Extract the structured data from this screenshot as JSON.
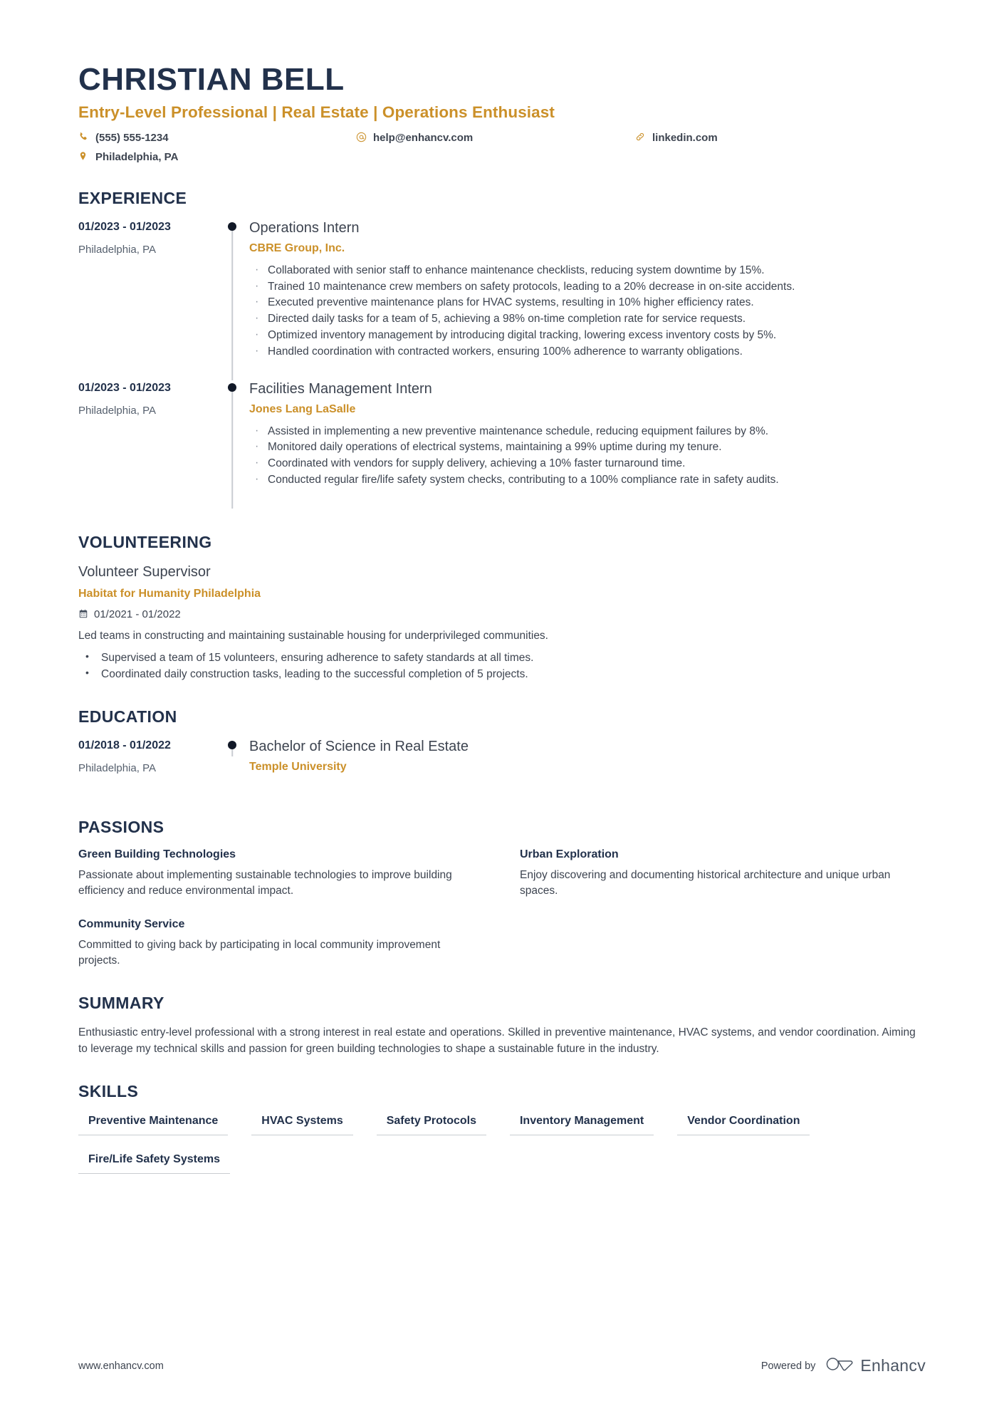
{
  "header": {
    "name": "CHRISTIAN BELL",
    "headline": "Entry-Level Professional | Real Estate | Operations Enthusiast",
    "contacts": [
      {
        "icon": "phone-icon",
        "value": "(555) 555-1234"
      },
      {
        "icon": "email-icon",
        "value": "help@enhancv.com"
      },
      {
        "icon": "link-icon",
        "value": "linkedin.com"
      },
      {
        "icon": "location-pin-icon",
        "value": "Philadelphia, PA"
      }
    ]
  },
  "colors": {
    "accent": "#cb9029",
    "heading": "#22314b",
    "body": "#3d4450",
    "rule": "#c9ccd1"
  },
  "experience": {
    "title": "EXPERIENCE",
    "entries": [
      {
        "date": "01/2023 - 01/2023",
        "location": "Philadelphia, PA",
        "role": "Operations Intern",
        "company": "CBRE Group, Inc.",
        "bullets": [
          "Collaborated with senior staff to enhance maintenance checklists, reducing system downtime by 15%.",
          "Trained 10 maintenance crew members on safety protocols, leading to a 20% decrease in on-site accidents.",
          "Executed preventive maintenance plans for HVAC systems, resulting in 10% higher efficiency rates.",
          "Directed daily tasks for a team of 5, achieving a 98% on-time completion rate for service requests.",
          "Optimized inventory management by introducing digital tracking, lowering excess inventory costs by 5%.",
          "Handled coordination with contracted workers, ensuring 100% adherence to warranty obligations."
        ]
      },
      {
        "date": "01/2023 - 01/2023",
        "location": "Philadelphia, PA",
        "role": "Facilities Management Intern",
        "company": "Jones Lang LaSalle",
        "bullets": [
          "Assisted in implementing a new preventive maintenance schedule, reducing equipment failures by 8%.",
          "Monitored daily operations of electrical systems, maintaining a 99% uptime during my tenure.",
          "Coordinated with vendors for supply delivery, achieving a 10% faster turnaround time.",
          "Conducted regular fire/life safety system checks, contributing to a 100% compliance rate in safety audits."
        ]
      }
    ]
  },
  "volunteering": {
    "title": "VOLUNTEERING",
    "role": "Volunteer Supervisor",
    "organization": "Habitat for Humanity Philadelphia",
    "date": "01/2021 - 01/2022",
    "description": "Led teams in constructing and maintaining sustainable housing for underprivileged communities.",
    "bullets": [
      "Supervised a team of 15 volunteers, ensuring adherence to safety standards at all times.",
      "Coordinated daily construction tasks, leading to the successful completion of 5 projects."
    ]
  },
  "education": {
    "title": "EDUCATION",
    "date": "01/2018 - 01/2022",
    "location": "Philadelphia, PA",
    "degree": "Bachelor of Science in Real Estate",
    "school": "Temple University"
  },
  "passions": {
    "title": "PASSIONS",
    "items": [
      {
        "name": "Green Building Technologies",
        "description": "Passionate about implementing sustainable technologies to improve building efficiency and reduce environmental impact."
      },
      {
        "name": "Urban Exploration",
        "description": "Enjoy discovering and documenting historical architecture and unique urban spaces."
      },
      {
        "name": "Community Service",
        "description": "Committed to giving back by participating in local community improvement projects."
      }
    ]
  },
  "summary": {
    "title": "SUMMARY",
    "text": "Enthusiastic entry-level professional with a strong interest in real estate and operations. Skilled in preventive maintenance, HVAC systems, and vendor coordination. Aiming to leverage my technical skills and passion for green building technologies to shape a sustainable future in the industry."
  },
  "skills": {
    "title": "SKILLS",
    "items": [
      "Preventive Maintenance",
      "HVAC Systems",
      "Safety Protocols",
      "Inventory Management",
      "Vendor Coordination",
      "Fire/Life Safety Systems"
    ]
  },
  "footer": {
    "url": "www.enhancv.com",
    "powered_by": "Powered by",
    "brand": "Enhancv"
  }
}
